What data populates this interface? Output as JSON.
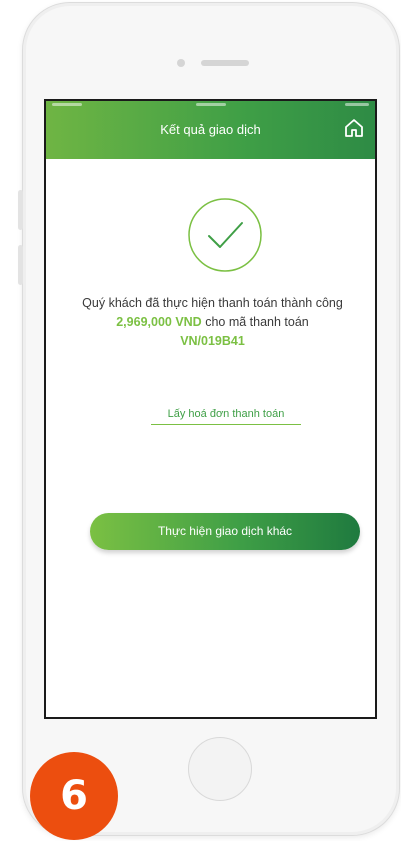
{
  "header": {
    "title": "Kết quả giao dịch",
    "home_icon": "home-icon"
  },
  "result": {
    "status_icon": "check-circle-icon",
    "message_part1": "Quý khách đã thực hiện thanh toán thành công ",
    "amount": "2,969,000 VND",
    "message_part2": " cho mã thanh toán ",
    "payment_code": "VN/019B41"
  },
  "actions": {
    "invoice_link_label": "Lấy hoá đơn thanh toán",
    "new_transaction_label": "Thực hiện giao dịch khác"
  },
  "step_badge": {
    "number": "6"
  },
  "colors": {
    "accent_green": "#7bc043",
    "dark_green": "#2e8b45",
    "badge_orange": "#ec4e0f"
  }
}
